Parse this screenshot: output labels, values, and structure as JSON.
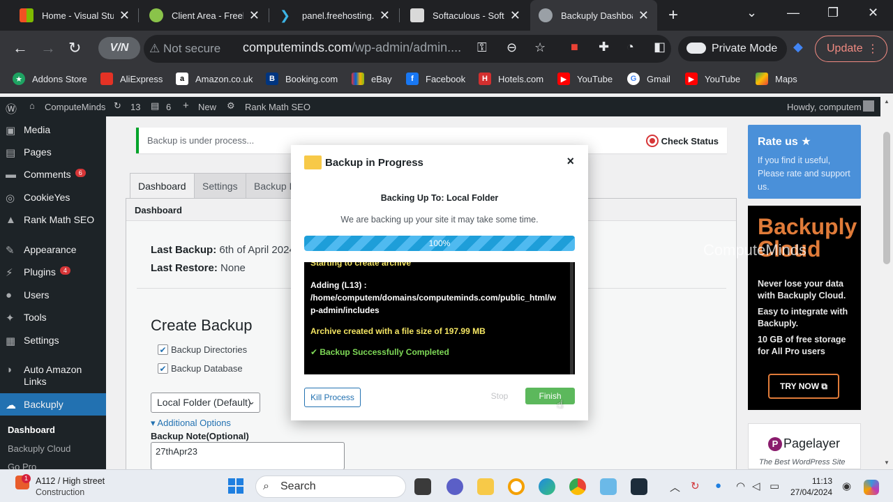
{
  "browser": {
    "tabs": [
      {
        "title": "Home - Visual Stu",
        "favicon": "windows-icon"
      },
      {
        "title": "Client Area - Freeh",
        "favicon": "globe-icon"
      },
      {
        "title": "panel.freehosting.",
        "favicon": "chevron-icon"
      },
      {
        "title": "Softaculous - Soft",
        "favicon": "softaculous-icon"
      },
      {
        "title": "Backuply Dashboa",
        "favicon": "globe-icon"
      }
    ],
    "vpn_label": "V/N",
    "not_secure": "Not secure",
    "url_main": "computeminds.com",
    "url_path": "/wp-admin/admin....",
    "private_mode": "Private Mode",
    "update_label": "Update",
    "bookmarks": [
      {
        "label": "Addons Store",
        "color": "#1ea362"
      },
      {
        "label": "AliExpress",
        "color": "#e43225"
      },
      {
        "label": "Amazon.co.uk",
        "color": "#ffffff"
      },
      {
        "label": "Booking.com",
        "color": "#003580"
      },
      {
        "label": "eBay",
        "color": "#e53238"
      },
      {
        "label": "Facebook",
        "color": "#1877f2"
      },
      {
        "label": "Hotels.com",
        "color": "#d32f2f"
      },
      {
        "label": "YouTube",
        "color": "#ff0000"
      },
      {
        "label": "Gmail",
        "color": "#ffffff"
      },
      {
        "label": "YouTube",
        "color": "#ff0000"
      },
      {
        "label": "Maps",
        "color": "#34a853"
      }
    ]
  },
  "adminbar": {
    "site": "ComputeMinds",
    "updates": "13",
    "comments": "6",
    "new": "New",
    "seo": "Rank Math SEO",
    "howdy": "Howdy, computem"
  },
  "sidebar": {
    "items": [
      {
        "label": "Media"
      },
      {
        "label": "Pages"
      },
      {
        "label": "Comments",
        "badge": "6"
      },
      {
        "label": "CookieYes"
      },
      {
        "label": "Rank Math SEO"
      },
      {
        "label": "Appearance"
      },
      {
        "label": "Plugins",
        "badge": "4"
      },
      {
        "label": "Users"
      },
      {
        "label": "Tools"
      },
      {
        "label": "Settings"
      },
      {
        "label": "Auto Amazon Links"
      },
      {
        "label": "Backuply"
      }
    ],
    "sub": [
      "Dashboard",
      "Backuply Cloud",
      "Go Pro"
    ]
  },
  "main": {
    "notice": "Backup is under process...",
    "check_status": "Check Status",
    "tabs": [
      "Dashboard",
      "Settings",
      "Backup L"
    ],
    "panel_title": "Dashboard",
    "last_backup_label": "Last Backup:",
    "last_backup_value": "6th of April 2024",
    "last_restore_label": "Last Restore:",
    "last_restore_value": "None",
    "create_backup": "Create Backup",
    "backup_directories": "Backup Directories",
    "backup_database": "Backup Database",
    "location": "Local Folder (Default)",
    "additional_options": "▾ Additional Options",
    "note_label": "Backup Note(Optional)",
    "note_value": "27thApr23"
  },
  "right": {
    "rate_title": "Rate us",
    "rate_body": "If you find it useful, Please rate and support us.",
    "brand": "Backuply\nCloud",
    "cloud_p1": "Never lose your data with Backuply Cloud.",
    "cloud_p2": "Easy to integrate with Backuply.",
    "cloud_p3": "10 GB of free storage for All Pro users",
    "try_now": "TRY NOW",
    "watermark": "ComputeMinds",
    "pagelayer": "Pagelayer",
    "pagelayer_sub": "The Best WordPress Site"
  },
  "modal": {
    "title": "Backup in Progress",
    "close": "×",
    "backing_up_to": "Backing Up To: Local Folder",
    "message": "We are backing up your site it may take some time.",
    "progress": 100,
    "progress_label": "100%",
    "log": {
      "l1": "Starting to create archive",
      "l2": "Adding (L13) :",
      "l3": "/home/computem/domains/computeminds.com/public_html/w",
      "l4": "p-admin/includes",
      "l5": "Archive created with a file size of 197.99 MB",
      "l6": "✔ Backup Successfully Completed"
    },
    "kill_process": "Kill Process",
    "stop": "Stop",
    "finish": "Finish"
  },
  "taskbar": {
    "weather_title": "A112 / High street",
    "weather_sub": "Construction",
    "search": "Search",
    "time": "11:13",
    "date": "27/04/2024"
  }
}
